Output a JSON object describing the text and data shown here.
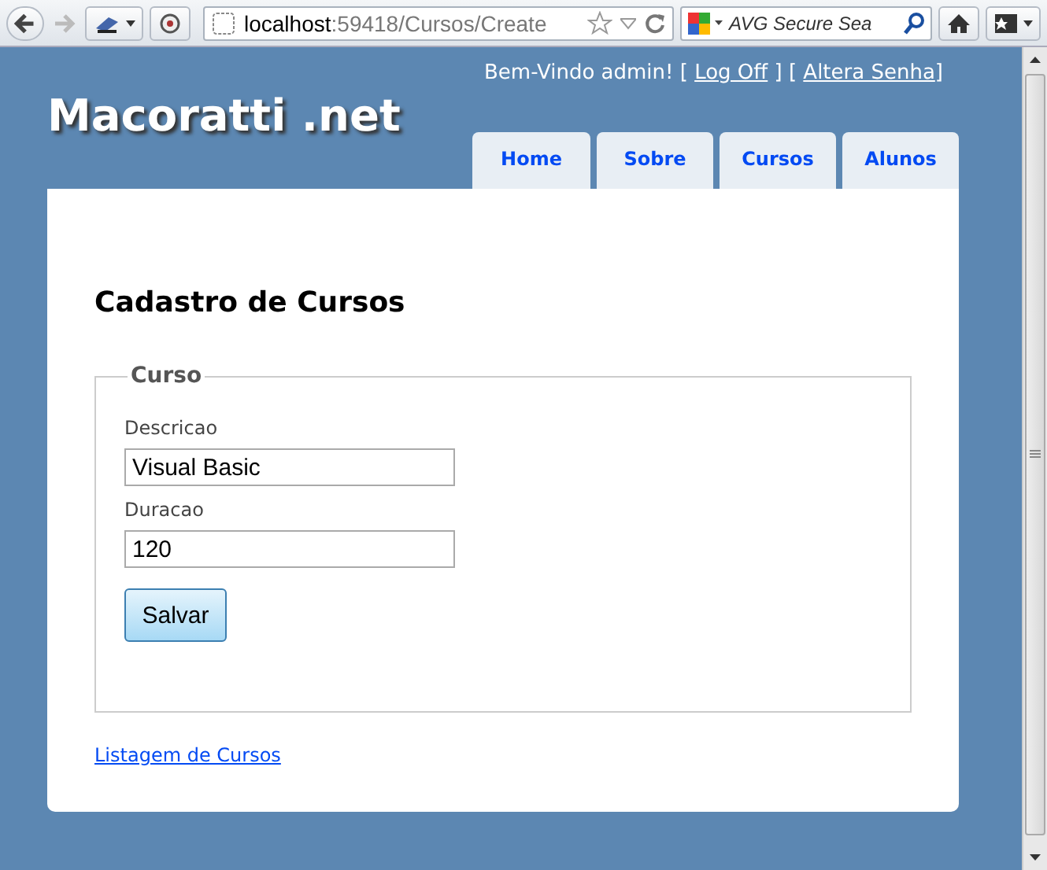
{
  "browser": {
    "url_host": "localhost",
    "url_rest": ":59418/Cursos/Create",
    "search_placeholder": "AVG Secure Sea"
  },
  "header": {
    "welcome": [
      {
        "kind": "text",
        "text": "Bem-Vindo admin! [ "
      },
      {
        "kind": "link",
        "text": "Log Off"
      },
      {
        "kind": "text",
        "text": " ] [ "
      },
      {
        "kind": "link",
        "text": "Altera Senha"
      },
      {
        "kind": "text",
        "text": "]"
      }
    ],
    "logo": "Macoratti .net",
    "tabs": [
      {
        "label": "Home"
      },
      {
        "label": "Sobre"
      },
      {
        "label": "Cursos"
      },
      {
        "label": "Alunos"
      }
    ]
  },
  "main": {
    "title": "Cadastro de Cursos",
    "fieldset": {
      "legend": "Curso",
      "fields": [
        {
          "label": "Descricao",
          "value": "Visual Basic"
        },
        {
          "label": "Duracao",
          "value": "120"
        }
      ],
      "submit": "Salvar"
    },
    "back_link": "Listagem de Cursos"
  }
}
